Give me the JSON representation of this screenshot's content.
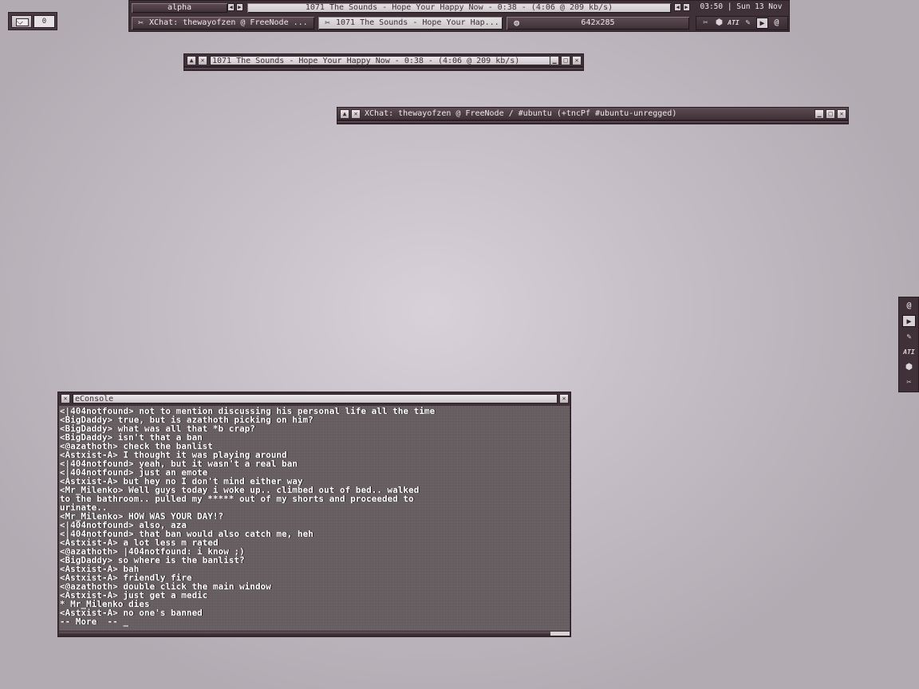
{
  "mail": {
    "count": "0",
    "icon": "envelope-icon"
  },
  "panel": {
    "desktop_name": "alpha",
    "now_playing": "1071 The Sounds - Hope Your Happy Now - 0:38 - (4:06 @ 209 kb/s)",
    "clock": "03:50 | Sun 13 Nov",
    "tasks": [
      {
        "label": "XChat: thewayofzen @ FreeNode ...",
        "icon": "xchat-icon"
      },
      {
        "label": "1071 The Sounds - Hope Your Hap...",
        "icon": "xmms-icon"
      },
      {
        "label": "642x285",
        "icon": "resize-icon"
      }
    ],
    "tray_icons": [
      "scissors-icon",
      "box-icon",
      "ati-icon",
      "pen-icon",
      "play-icon",
      "swirl-icon"
    ]
  },
  "audio_window": {
    "title": "1071 The Sounds - Hope Your Happy Now - 0:38 - (4:06 @ 209 kb/s)"
  },
  "xchat_window": {
    "title": "XChat: thewayofzen @ FreeNode / #ubuntu (+tncPf #ubuntu-unregged)"
  },
  "dock_icons": [
    "swirl-icon",
    "play-icon",
    "pen-icon",
    "ati-icon",
    "box-icon",
    "scissors-icon"
  ],
  "econsole": {
    "title": "eConsole",
    "lines": [
      "<|404notfound> not to mention discussing his personal life all the time",
      "<BigDaddy> true, but is azathoth picking on him?",
      "<BigDaddy> what was all that *b crap?",
      "<BigDaddy> isn't that a ban",
      "<@azathoth> check the banlist",
      "<Astxist-A> I thought it was playing around",
      "<|404notfound> yeah, but it wasn't a real ban",
      "<|404notfound> just an emote",
      "<Astxist-A> but hey no I don't mind either way",
      "<Mr_Milenko> Well guys today i woke up.. climbed out of bed.. walked",
      "to the bathroom.. pulled my ***** out of my shorts and proceeded to",
      "urinate..",
      "<Mr_Milenko> HOW WAS YOUR DAY!?",
      "<|404notfound> also, aza",
      "<|404notfound> that ban would also catch me, heh",
      "<Astxist-A> a lot less m rated",
      "<@azathoth> |404notfound: i know ;)",
      "<BigDaddy> so where is the banlist?",
      "<Astxist-A> bah",
      "<Astxist-A> friendly fire",
      "<@azathoth> double click the main window",
      "<Astxist-A> just get a medic",
      "* Mr_Milenko dies",
      "<Astxist-A> no one's banned",
      "-- More  -- _"
    ]
  }
}
